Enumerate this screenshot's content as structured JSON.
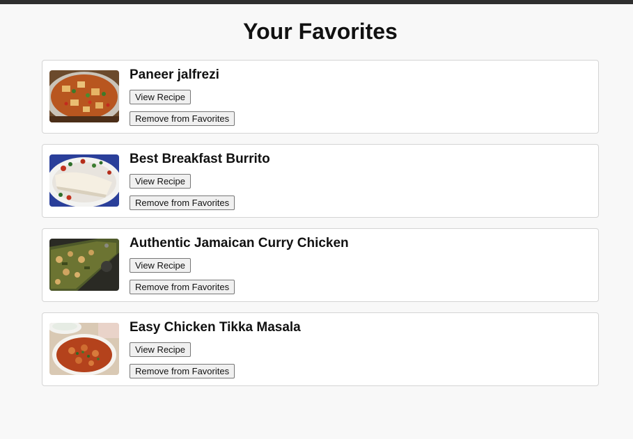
{
  "page": {
    "title": "Your Favorites"
  },
  "favorites": [
    {
      "name": "Paneer jalfrezi",
      "view_label": "View Recipe",
      "remove_label": "Remove from Favorites",
      "image": "paneer-jalfrezi-photo"
    },
    {
      "name": "Best Breakfast Burrito",
      "view_label": "View Recipe",
      "remove_label": "Remove from Favorites",
      "image": "breakfast-burrito-photo"
    },
    {
      "name": "Authentic Jamaican Curry Chicken",
      "view_label": "View Recipe",
      "remove_label": "Remove from Favorites",
      "image": "jamaican-curry-chicken-photo"
    },
    {
      "name": "Easy Chicken Tikka Masala",
      "view_label": "View Recipe",
      "remove_label": "Remove from Favorites",
      "image": "chicken-tikka-masala-photo"
    }
  ],
  "colors": {
    "background": "#f8f8f8",
    "card_background": "#ffffff",
    "card_border": "#d4d4d4",
    "top_bar": "#2f2f2f"
  }
}
